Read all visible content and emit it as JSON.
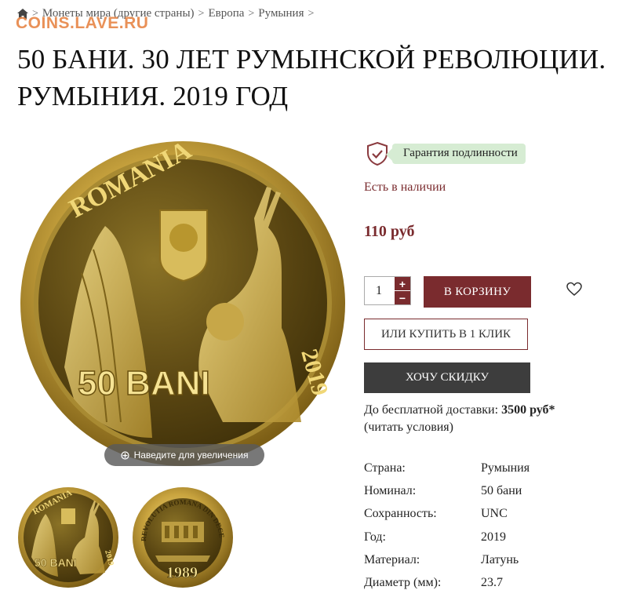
{
  "breadcrumb": {
    "items": [
      "Монеты мира (другие страны)",
      "Европа",
      "Румыния"
    ],
    "separator": ">"
  },
  "watermark": "COINS.LAVE.RU",
  "title_line1": "50 БАНИ. 30 ЛЕТ РУМЫНСКОЙ РЕВОЛЮЦИИ.",
  "title_line2": "РУМЫНИЯ. 2019 ГОД",
  "coin": {
    "top_legend": "ROMANIA",
    "year": "2019",
    "denomination": "50 BANI",
    "reverse_legend": "REVOLUTIA ROMANA DIN DECEMBRIE",
    "reverse_year": "1989",
    "zoom_hint": "Наведите для увеличения"
  },
  "guarantee": "Гарантия подлинности",
  "stock": "Есть в наличии",
  "price": "110 руб",
  "quantity": "1",
  "buttons": {
    "cart": "В КОРЗИНУ",
    "one_click": "ИЛИ КУПИТЬ В 1 КЛИК",
    "discount": "ХОЧУ СКИДКУ"
  },
  "delivery": {
    "prefix": "До бесплатной доставки:",
    "amount": "3500 руб*",
    "link": "(читать условия)"
  },
  "specs": [
    {
      "key": "Страна:",
      "value": "Румыния"
    },
    {
      "key": "Номинал:",
      "value": "50 бани"
    },
    {
      "key": "Сохранность:",
      "value": "UNC"
    },
    {
      "key": "Год:",
      "value": "2019"
    },
    {
      "key": "Материал:",
      "value": "Латунь"
    },
    {
      "key": "Диаметр (мм):",
      "value": "23.7"
    }
  ],
  "colors": {
    "accent": "#7a2b2e",
    "dark_button": "#3d3d3d",
    "badge_bg": "#d6ecd3",
    "coin_gold": "#b8962e"
  },
  "icons": [
    "home-icon",
    "shield-check-icon",
    "heart-icon",
    "zoom-icon",
    "plus-icon",
    "minus-icon"
  ]
}
